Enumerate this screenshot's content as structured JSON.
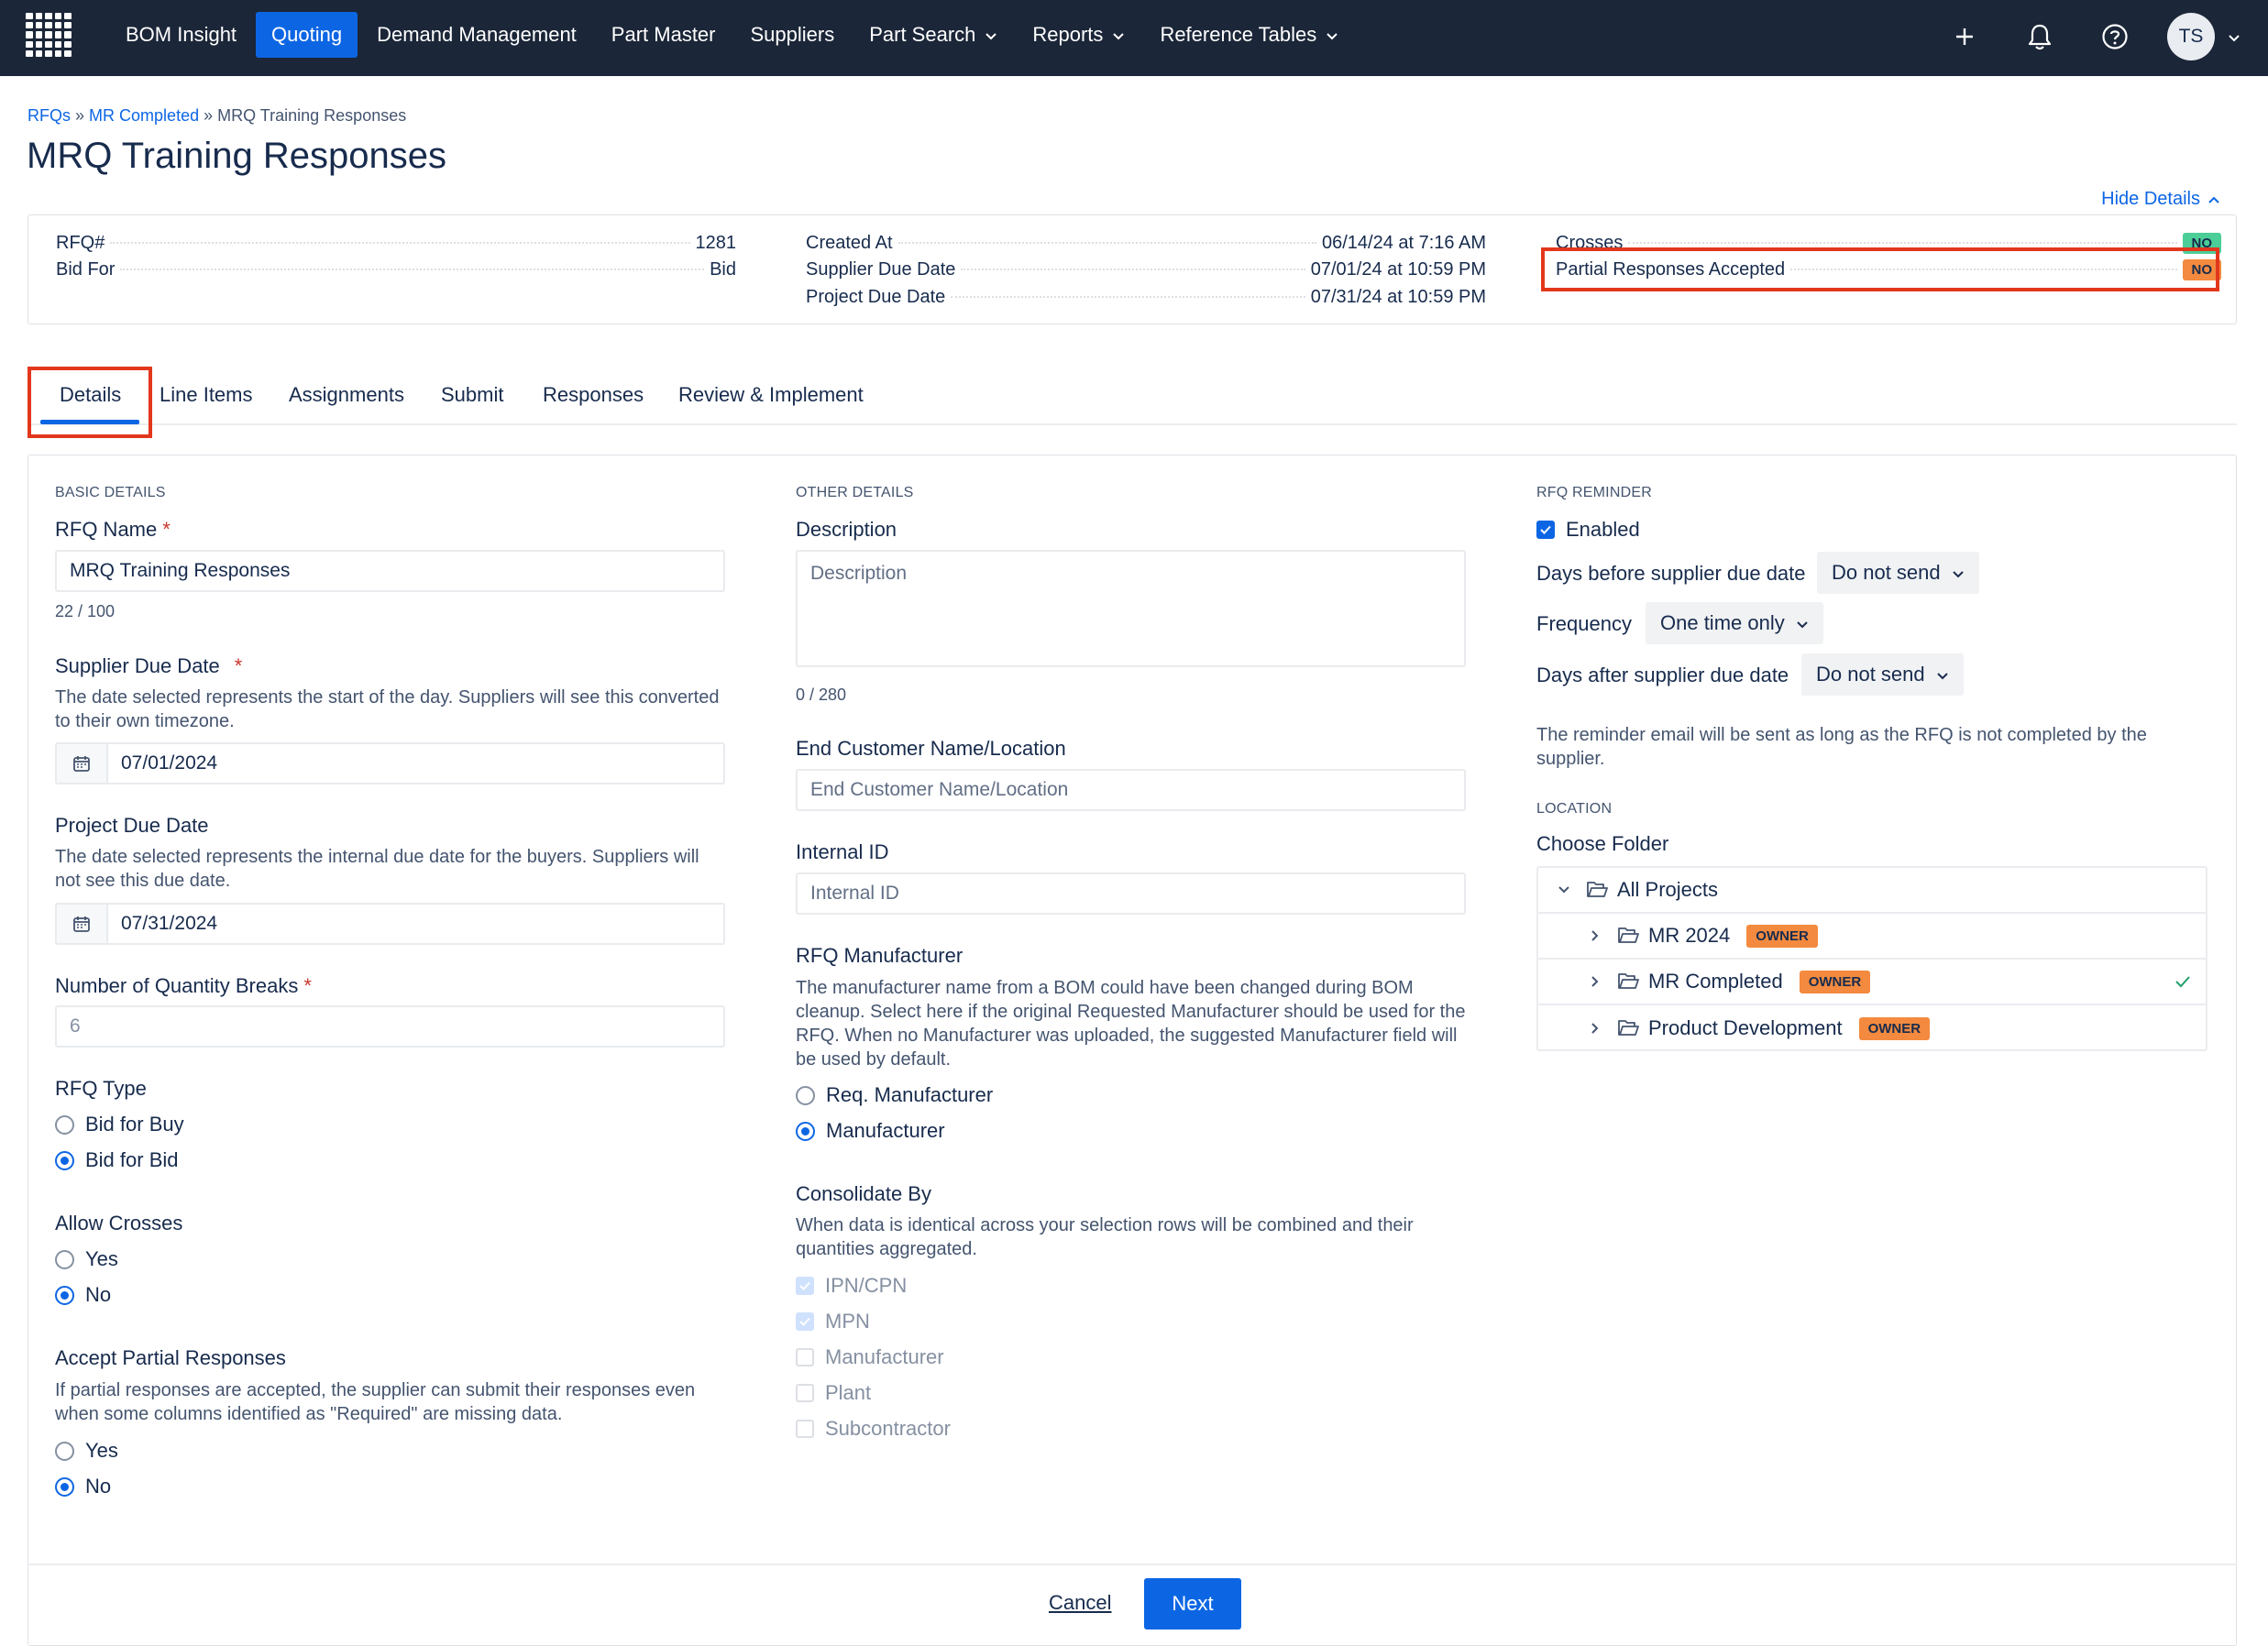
{
  "nav": {
    "items": [
      {
        "label": "BOM Insight",
        "active": false,
        "dropdown": false
      },
      {
        "label": "Quoting",
        "active": true,
        "dropdown": false
      },
      {
        "label": "Demand Management",
        "active": false,
        "dropdown": false
      },
      {
        "label": "Part Master",
        "active": false,
        "dropdown": false
      },
      {
        "label": "Suppliers",
        "active": false,
        "dropdown": false
      },
      {
        "label": "Part Search",
        "active": false,
        "dropdown": true
      },
      {
        "label": "Reports",
        "active": false,
        "dropdown": true
      },
      {
        "label": "Reference Tables",
        "active": false,
        "dropdown": true
      }
    ],
    "user_initials": "TS",
    "icons": [
      "plus-icon",
      "bell-icon",
      "help-icon"
    ],
    "active_color": "#0c66e4",
    "bar_color": "#1b2638"
  },
  "breadcrumb": {
    "link1": "RFQs",
    "sep": "»",
    "link2": "MR Completed",
    "current": "MRQ Training Responses"
  },
  "page_title": "MRQ Training Responses",
  "hide_details": "Hide Details",
  "summary": {
    "rfq_label": "RFQ#",
    "rfq_value": "1281",
    "bid_for_label": "Bid For",
    "bid_for_value": "Bid",
    "created_at_label": "Created At",
    "created_at_value": "06/14/24 at 7:16 AM",
    "supplier_due_label": "Supplier Due Date",
    "supplier_due_value": "07/01/24 at 10:59 PM",
    "project_due_label": "Project Due Date",
    "project_due_value": "07/31/24 at 10:59 PM",
    "crosses_label": "Crosses",
    "crosses_value": "NO",
    "partial_label": "Partial Responses Accepted",
    "partial_value": "NO"
  },
  "tabs": [
    "Details",
    "Line Items",
    "Assignments",
    "Submit",
    "Responses",
    "Review & Implement"
  ],
  "basic": {
    "heading": "BASIC DETAILS",
    "rfq_name_label": "RFQ Name",
    "rfq_name_value": "MRQ Training Responses",
    "rfq_name_counter": "22 / 100",
    "supplier_due_label": "Supplier Due Date",
    "supplier_due_help": "The date selected represents the start of the day. Suppliers will see this converted to their own timezone.",
    "supplier_due_value": "07/01/2024",
    "project_due_label": "Project Due Date",
    "project_due_help": "The date selected represents the internal due date for the buyers. Suppliers will not see this due date.",
    "project_due_value": "07/31/2024",
    "qty_breaks_label": "Number of Quantity Breaks",
    "qty_breaks_value": "6",
    "rfq_type_label": "RFQ Type",
    "rfq_type_options": [
      "Bid for Buy",
      "Bid for Bid"
    ],
    "rfq_type_selected": "Bid for Bid",
    "allow_crosses_label": "Allow Crosses",
    "yes": "Yes",
    "no": "No",
    "allow_crosses_selected": "No",
    "partial_label": "Accept Partial Responses",
    "partial_help": "If partial responses are accepted, the supplier can submit their responses even when some columns identified as \"Required\" are missing data.",
    "partial_selected": "No"
  },
  "other": {
    "heading": "OTHER DETAILS",
    "description_label": "Description",
    "description_placeholder": "Description",
    "description_counter": "0 / 280",
    "end_customer_label": "End Customer Name/Location",
    "end_customer_placeholder": "End Customer Name/Location",
    "internal_id_label": "Internal ID",
    "internal_id_placeholder": "Internal ID",
    "manufacturer_label": "RFQ Manufacturer",
    "manufacturer_help": "The manufacturer name from a BOM could have been changed during BOM cleanup. Select here if the original Requested Manufacturer should be used for the RFQ. When no Manufacturer was uploaded, the suggested Manufacturer field will be used by default.",
    "manufacturer_options": [
      "Req. Manufacturer",
      "Manufacturer"
    ],
    "manufacturer_selected": "Manufacturer",
    "consolidate_label": "Consolidate By",
    "consolidate_help": "When data is identical across your selection rows will be combined and their quantities aggregated.",
    "consolidate_options": [
      {
        "label": "IPN/CPN",
        "checked": true
      },
      {
        "label": "MPN",
        "checked": true
      },
      {
        "label": "Manufacturer",
        "checked": false
      },
      {
        "label": "Plant",
        "checked": false
      },
      {
        "label": "Subcontractor",
        "checked": false
      }
    ]
  },
  "reminder": {
    "heading": "RFQ REMINDER",
    "enabled_label": "Enabled",
    "enabled": true,
    "days_before_label": "Days before supplier due date",
    "days_before_value": "Do not send",
    "frequency_label": "Frequency",
    "frequency_value": "One time only",
    "days_after_label": "Days after supplier due date",
    "days_after_value": "Do not send",
    "note": "The reminder email will be sent as long as the RFQ is not completed by the supplier."
  },
  "location": {
    "heading": "LOCATION",
    "choose_folder_label": "Choose Folder",
    "root": "All Projects",
    "folders": [
      {
        "name": "MR 2024",
        "badge": "OWNER",
        "selected": false
      },
      {
        "name": "MR Completed",
        "badge": "OWNER",
        "selected": true
      },
      {
        "name": "Product Development",
        "badge": "OWNER",
        "selected": false
      }
    ]
  },
  "footer": {
    "cancel": "Cancel",
    "next": "Next"
  }
}
